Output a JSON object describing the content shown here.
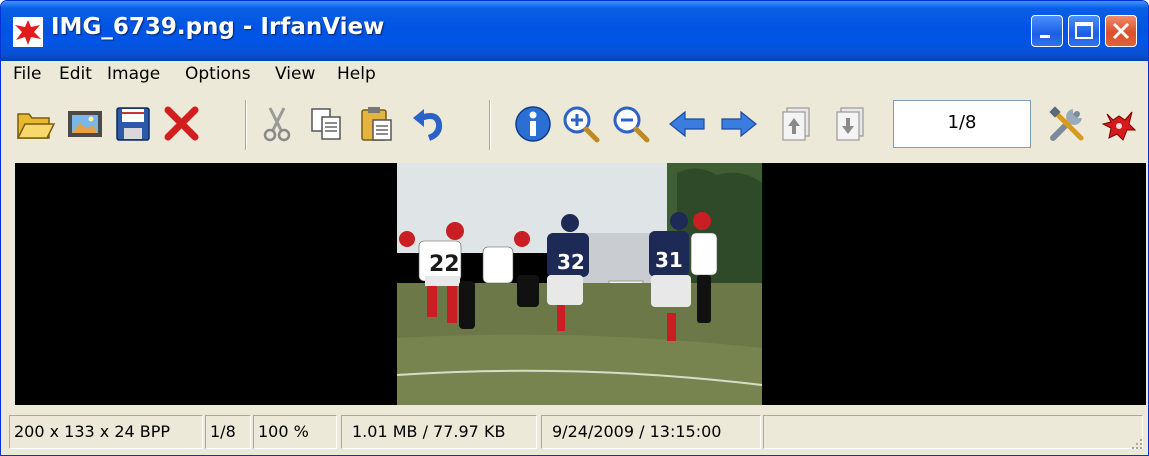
{
  "window": {
    "title": "IMG_6739.png - IrfanView"
  },
  "menu": [
    "File",
    "Edit",
    "Image",
    "Options",
    "View",
    "Help"
  ],
  "toolbar": {
    "page_indicator": "1/8",
    "buttons": [
      "open-icon",
      "slideshow-icon",
      "save-icon",
      "delete-icon",
      "cut-icon",
      "copy-icon",
      "paste-icon",
      "undo-icon",
      "info-icon",
      "zoom-in-icon",
      "zoom-out-icon",
      "previous-icon",
      "next-icon",
      "first-page-icon",
      "last-page-icon",
      "properties-icon",
      "irfanview-icon"
    ]
  },
  "status": {
    "dimensions": "200 x 133 x 24 BPP",
    "page": "1/8",
    "zoom": "100 %",
    "size": "1.01 MB / 77.97 KB",
    "datetime": "9/24/2009 / 13:15:00"
  },
  "colors": {
    "titlebar": "#0054e3",
    "chrome": "#ece9d8",
    "canvas": "#000000",
    "close_button": "#d9502a"
  }
}
